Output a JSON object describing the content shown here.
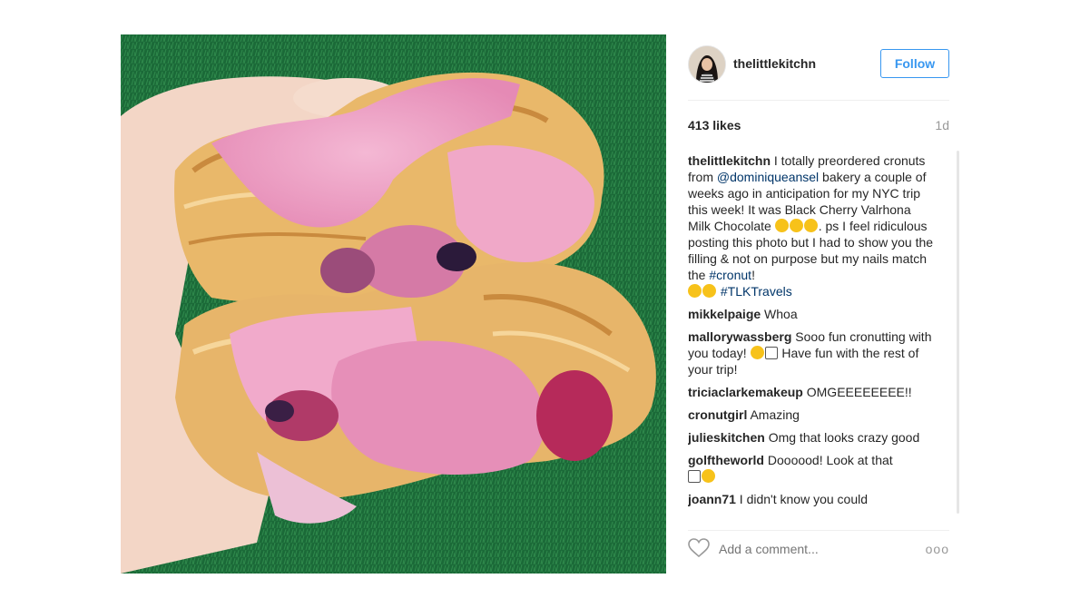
{
  "post": {
    "image_alt": "Cronut with pink glaze and black cherry filling held in a hand"
  },
  "header": {
    "username": "thelittlekitchn",
    "follow_label": "Follow"
  },
  "meta": {
    "likes": "413 likes",
    "time": "1d"
  },
  "caption": {
    "user": "thelittlekitchn",
    "part1": " I totally preordered cronuts from ",
    "mention": "@dominiqueansel",
    "part2": " bakery a couple of weeks ago in anticipation for my NYC trip this week! It was Black Cherry Valrhona Milk Chocolate ",
    "part3": ". ps I feel ridiculous posting this photo but I had to show you the filling & not on purpose but my nails match the ",
    "hashtag1": "#cronut",
    "part4": "! ",
    "hashtag2": "#TLKTravels"
  },
  "comments": [
    {
      "user": "mikkelpaige",
      "text": " Whoa"
    },
    {
      "user": "mallorywassberg",
      "text": " Sooo fun cronutting with you today! ",
      "text2": " Have fun with the rest of your trip!"
    },
    {
      "user": "triciaclarkemakeup",
      "text": " OMGEEEEEEEE!!"
    },
    {
      "user": "cronutgirl",
      "text": " Amazing"
    },
    {
      "user": "julieskitchen",
      "text": " Omg that looks crazy good"
    },
    {
      "user": "golftheworld",
      "text": " Doooood! Look at that"
    },
    {
      "user": "joann71",
      "text": " I didn't know you could"
    }
  ],
  "footer": {
    "placeholder": "Add a comment...",
    "more": "ooo"
  },
  "icons": {
    "heart": "heart-icon",
    "more": "more-options-icon"
  },
  "colors": {
    "accent": "#3897f0",
    "link": "#003569",
    "muted": "#999999"
  }
}
